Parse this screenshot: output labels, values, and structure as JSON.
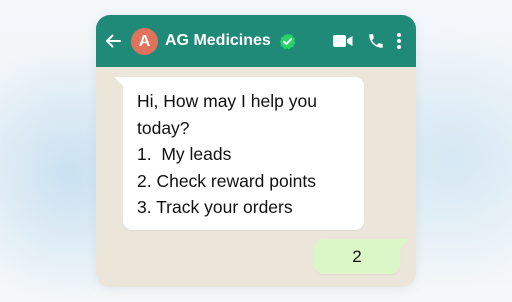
{
  "header": {
    "avatar_initial": "A",
    "contact_name": "AG Medicines",
    "verified": true,
    "icons": [
      "back-arrow-icon",
      "verified-icon",
      "video-call-icon",
      "phone-icon",
      "more-options-icon"
    ]
  },
  "messages": [
    {
      "direction": "incoming",
      "text": "Hi, How may I help you\ntoday?\n1.  My leads\n2. Check reward points\n3. Track your orders"
    },
    {
      "direction": "outgoing",
      "text": "2"
    }
  ],
  "colors": {
    "header": "#1f8a78",
    "avatar": "#e1725b",
    "verified_badge": "#25d366",
    "chat_background": "#ece5da",
    "incoming_bubble": "#ffffff",
    "outgoing_bubble": "#dbf7c7"
  }
}
